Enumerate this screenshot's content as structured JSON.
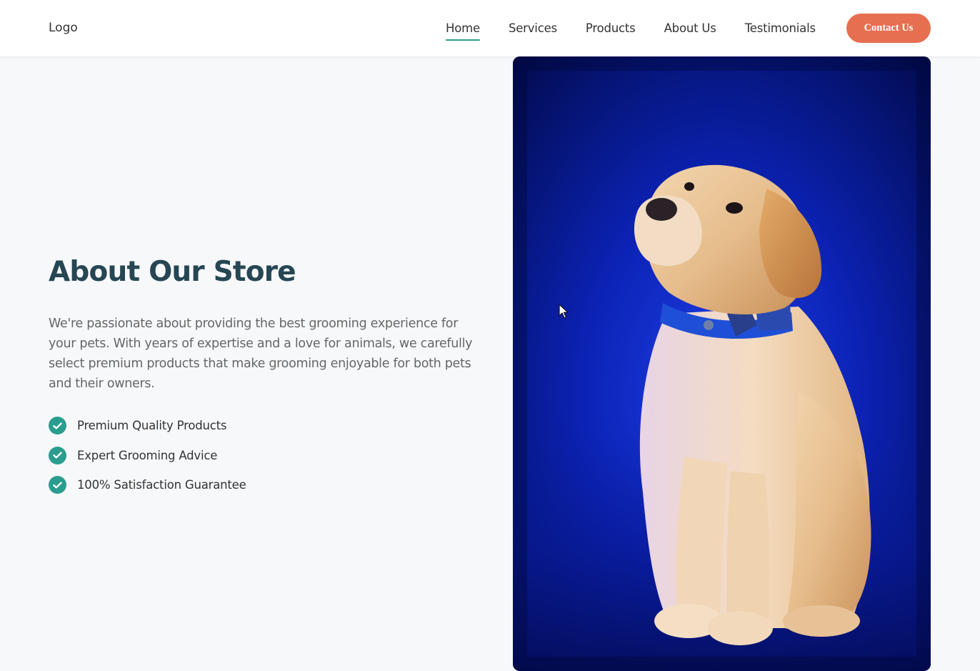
{
  "header": {
    "logo": "Logo",
    "nav": [
      {
        "label": "Home",
        "active": true
      },
      {
        "label": "Services",
        "active": false
      },
      {
        "label": "Products",
        "active": false
      },
      {
        "label": "About Us",
        "active": false
      },
      {
        "label": "Testimonials",
        "active": false
      }
    ],
    "contact_button": "Contact Us"
  },
  "about": {
    "title": "About Our Store",
    "description": "We're passionate about providing the best grooming experience for your pets. With years of expertise and a love for animals, we carefully select premium products that make grooming enjoyable for both pets and their owners.",
    "features": [
      {
        "label": "Premium Quality Products",
        "icon": "check-icon"
      },
      {
        "label": "Expert Grooming Advice",
        "icon": "check-icon"
      },
      {
        "label": "100% Satisfaction Guarantee",
        "icon": "check-icon"
      }
    ]
  },
  "image": {
    "subject": "puppy-photo",
    "background_color": "#0b22b0"
  },
  "colors": {
    "primary": "#2a9d8f",
    "accent": "#e76f51",
    "heading": "#264653",
    "text": "#666666"
  }
}
